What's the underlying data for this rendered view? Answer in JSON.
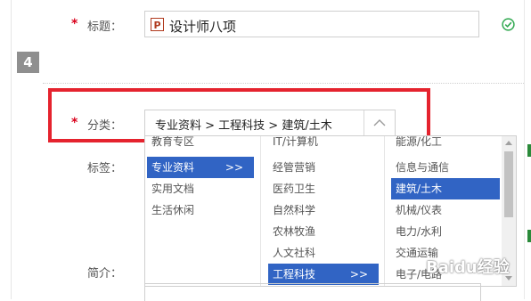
{
  "form": {
    "title_label": "标题：",
    "title_value": "设计师八项",
    "title_file_icon": "P",
    "step_number": "4",
    "category_label": "分类：",
    "category_value": "专业资料 > 工程科技 > 建筑/土木",
    "tags_label": "标签：",
    "intro_label": "简介：",
    "required_mark": "*"
  },
  "dropdown": {
    "col1": [
      {
        "label": "教育专区",
        "selected": false,
        "has_children": false
      },
      {
        "label": "专业资料",
        "selected": true,
        "has_children": true
      },
      {
        "label": "实用文档",
        "selected": false,
        "has_children": false
      },
      {
        "label": "生活休闲",
        "selected": false,
        "has_children": false
      }
    ],
    "col2": [
      {
        "label": "IT/计算机",
        "selected": false,
        "has_children": false
      },
      {
        "label": "经管营销",
        "selected": false,
        "has_children": false
      },
      {
        "label": "医药卫生",
        "selected": false,
        "has_children": false
      },
      {
        "label": "自然科学",
        "selected": false,
        "has_children": false
      },
      {
        "label": "农林牧渔",
        "selected": false,
        "has_children": false
      },
      {
        "label": "人文社科",
        "selected": false,
        "has_children": false
      },
      {
        "label": "工程科技",
        "selected": true,
        "has_children": true
      }
    ],
    "col3": [
      {
        "label": "能源/化工",
        "selected": false
      },
      {
        "label": "信息与通信",
        "selected": false
      },
      {
        "label": "建筑/土木",
        "selected": true
      },
      {
        "label": "机械/仪表",
        "selected": false
      },
      {
        "label": "电力/水利",
        "selected": false
      },
      {
        "label": "交通运输",
        "selected": false
      },
      {
        "label": "电子/电路",
        "selected": false
      }
    ],
    "more_glyph": ">>"
  },
  "watermark": "Baidu经验",
  "colors": {
    "selected_bg": "#3164c4",
    "highlight_border": "#e5232e",
    "required": "#d9001b",
    "ok_check": "#2fa84f"
  },
  "icons": {
    "file": "ppt-file-icon",
    "valid": "check-circle-icon",
    "dropdown": "chevron-up-icon",
    "scroll_up": "scroll-up-arrow-icon",
    "scroll_down": "scroll-down-arrow-icon"
  }
}
